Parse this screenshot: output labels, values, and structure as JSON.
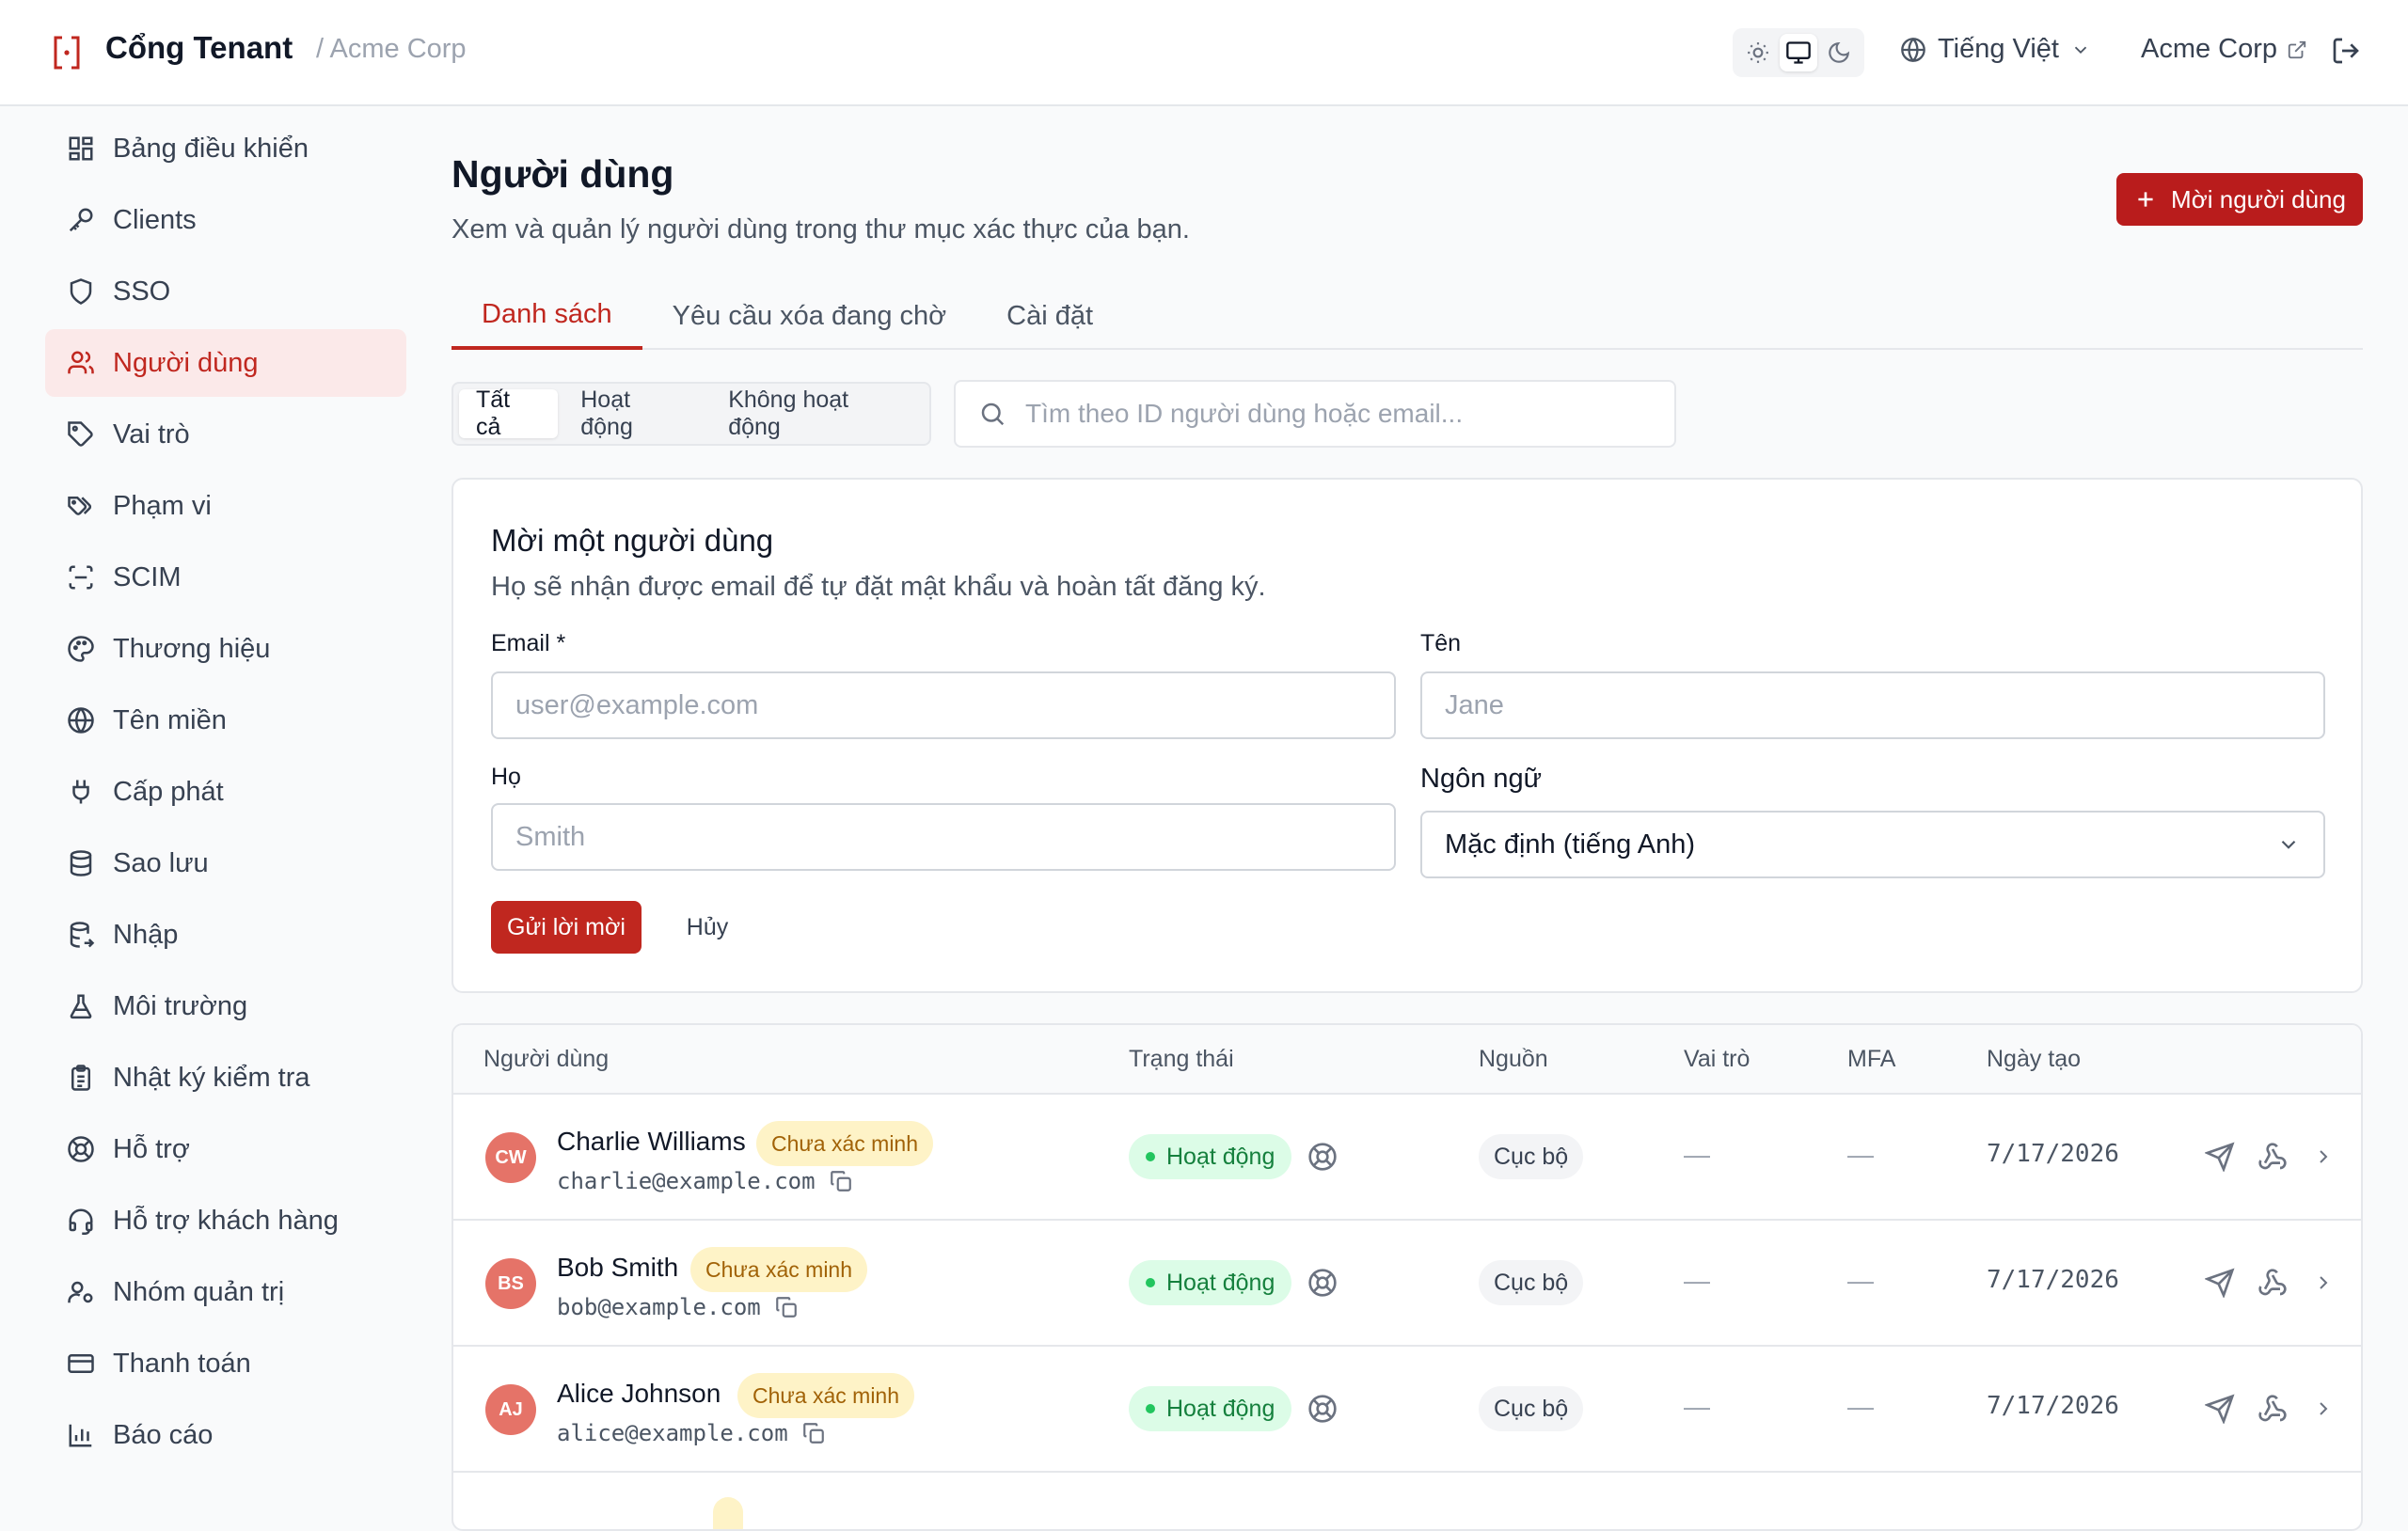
{
  "header": {
    "brand": "Cổng Tenant",
    "org_crumb": "/ Acme Corp",
    "language": "Tiếng Việt",
    "org_link": "Acme Corp"
  },
  "sidebar": {
    "items": [
      {
        "label": "Bảng điều khiển",
        "icon": "dashboard-icon"
      },
      {
        "label": "Clients",
        "icon": "key-icon"
      },
      {
        "label": "SSO",
        "icon": "shield-icon"
      },
      {
        "label": "Người dùng",
        "icon": "users-icon",
        "active": true
      },
      {
        "label": "Vai trò",
        "icon": "tag-icon"
      },
      {
        "label": "Phạm vi",
        "icon": "tags-icon"
      },
      {
        "label": "SCIM",
        "icon": "scan-icon"
      },
      {
        "label": "Thương hiệu",
        "icon": "palette-icon"
      },
      {
        "label": "Tên miền",
        "icon": "globe-icon"
      },
      {
        "label": "Cấp phát",
        "icon": "plug-icon"
      },
      {
        "label": "Sao lưu",
        "icon": "database-icon"
      },
      {
        "label": "Nhập",
        "icon": "database-import-icon"
      },
      {
        "label": "Môi trường",
        "icon": "flask-icon"
      },
      {
        "label": "Nhật ký kiểm tra",
        "icon": "clipboard-icon"
      },
      {
        "label": "Hỗ trợ",
        "icon": "lifebuoy-icon"
      },
      {
        "label": "Hỗ trợ khách hàng",
        "icon": "headset-icon"
      },
      {
        "label": "Nhóm quản trị",
        "icon": "user-cog-icon"
      },
      {
        "label": "Thanh toán",
        "icon": "credit-card-icon"
      },
      {
        "label": "Báo cáo",
        "icon": "bar-chart-icon"
      }
    ]
  },
  "main": {
    "title": "Người dùng",
    "subtitle": "Xem và quản lý người dùng trong thư mục xác thực của bạn.",
    "invite_button": "Mời người dùng",
    "tabs": [
      "Danh sách",
      "Yêu cầu xóa đang chờ",
      "Cài đặt"
    ],
    "filters": [
      "Tất cả",
      "Hoạt động",
      "Không hoạt động"
    ],
    "search_placeholder": "Tìm theo ID người dùng hoặc email..."
  },
  "invite_form": {
    "title": "Mời một người dùng",
    "subtitle": "Họ sẽ nhận được email để tự đặt mật khẩu và hoàn tất đăng ký.",
    "email_label": "Email *",
    "email_placeholder": "user@example.com",
    "first_name_label": "Tên",
    "first_name_placeholder": "Jane",
    "last_name_label": "Họ",
    "last_name_placeholder": "Smith",
    "language_label": "Ngôn ngữ",
    "language_value": "Mặc định (tiếng Anh)",
    "send_button": "Gửi lời mời",
    "cancel_button": "Hủy"
  },
  "table": {
    "columns": [
      "Người dùng",
      "Trạng thái",
      "Nguồn",
      "Vai trò",
      "MFA",
      "Ngày tạo"
    ],
    "rows": [
      {
        "initials": "CW",
        "name": "Charlie Williams",
        "badge": "Chưa xác minh",
        "email": "charlie@example.com",
        "status": "Hoạt động",
        "source": "Cục bộ",
        "roles": "—",
        "mfa": "—",
        "created": "7/17/2026"
      },
      {
        "initials": "BS",
        "name": "Bob Smith",
        "badge": "Chưa xác minh",
        "email": "bob@example.com",
        "status": "Hoạt động",
        "source": "Cục bộ",
        "roles": "—",
        "mfa": "—",
        "created": "7/17/2026"
      },
      {
        "initials": "AJ",
        "name": "Alice Johnson",
        "badge": "Chưa xác minh",
        "email": "alice@example.com",
        "status": "Hoạt động",
        "source": "Cục bộ",
        "roles": "—",
        "mfa": "—",
        "created": "7/17/2026"
      }
    ]
  },
  "colors": {
    "accent": "#c0271f",
    "accent_button": "#b91c1c",
    "active_nav_bg": "#fbe9e9",
    "status_active_bg": "#dcfce7",
    "unverified_bg": "#fef3c7"
  }
}
